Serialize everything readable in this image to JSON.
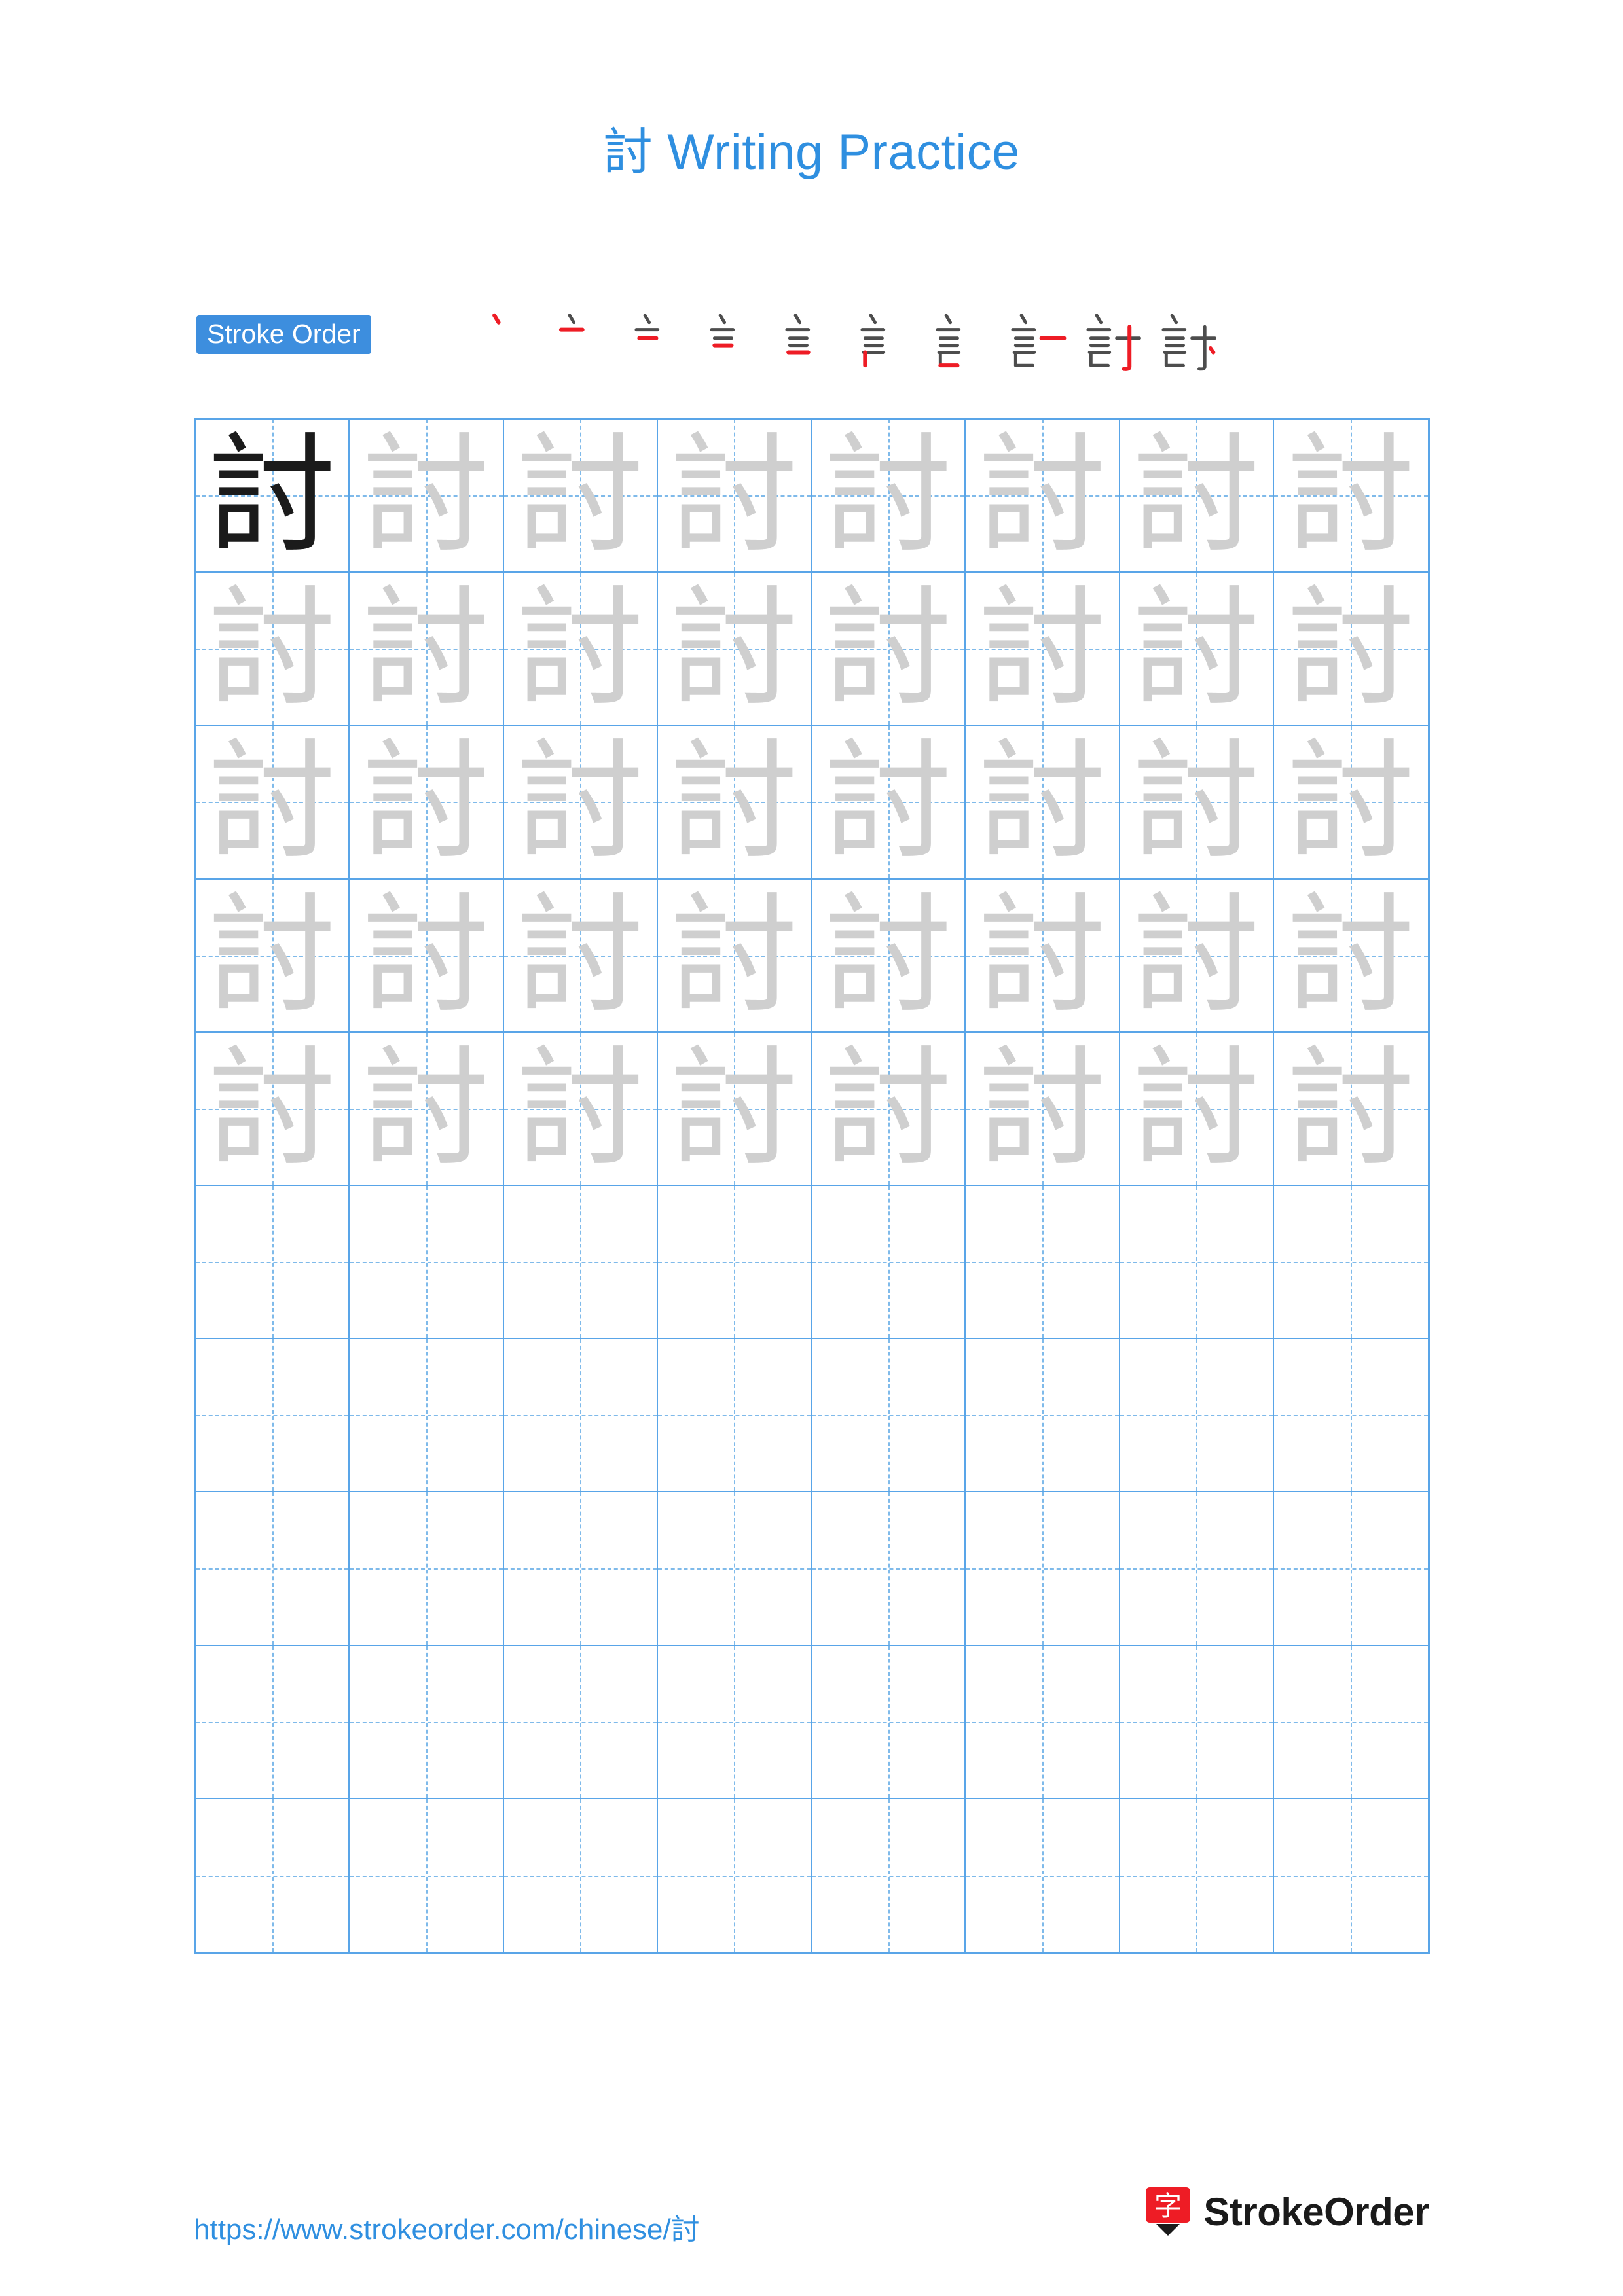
{
  "page": {
    "title_character": "討",
    "title_text": " Writing Practice"
  },
  "stroke_order": {
    "label": "Stroke Order",
    "character": "討",
    "total_strokes": 10,
    "steps": [
      {
        "index": 1,
        "partial": "丶"
      },
      {
        "index": 2,
        "partial": "亠"
      },
      {
        "index": 3,
        "partial": "言"
      },
      {
        "index": 4,
        "partial": "言"
      },
      {
        "index": 5,
        "partial": "言"
      },
      {
        "index": 6,
        "partial": "言"
      },
      {
        "index": 7,
        "partial": "言"
      },
      {
        "index": 8,
        "partial": "討"
      },
      {
        "index": 9,
        "partial": "討"
      },
      {
        "index": 10,
        "partial": "討"
      }
    ]
  },
  "practice_grid": {
    "columns": 8,
    "rows": 10,
    "character": "討",
    "filled_rows": 5,
    "dark_cells": [
      [
        0,
        0
      ]
    ],
    "empty_rows": 5
  },
  "footer": {
    "url": "https://www.strokeorder.com/chinese/討",
    "brand_name": "StrokeOrder",
    "brand_logo_character": "字"
  },
  "colors": {
    "accent": "#2f8fe0",
    "grid_line": "#59a5e8",
    "grid_dash": "#7fbaea",
    "stroke_highlight": "#ee1c25",
    "stroke_done": "#4d4d4d",
    "ghost_char": "#cfcfcf",
    "dark_char": "#1b1b1b"
  }
}
